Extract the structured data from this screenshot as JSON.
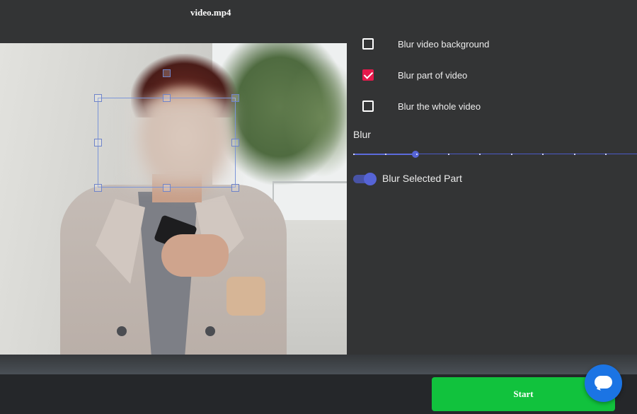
{
  "header": {
    "file_name": "video.mp4"
  },
  "options": [
    {
      "label": "Blur video background",
      "checked": false
    },
    {
      "label": "Blur part of video",
      "checked": true
    },
    {
      "label": "Blur the whole video",
      "checked": false
    }
  ],
  "blur": {
    "label": "Blur",
    "value_fraction": 0.22,
    "slider_color": "#5664d6"
  },
  "toggle": {
    "label": "Blur Selected Part",
    "on": true
  },
  "footer": {
    "start_label": "Start",
    "start_color": "#11c23d"
  },
  "chat": {
    "icon": "chat-bubble-icon",
    "color": "#1b74e4"
  },
  "colors": {
    "background": "#333435",
    "checkbox_checked": "#e6194b"
  }
}
